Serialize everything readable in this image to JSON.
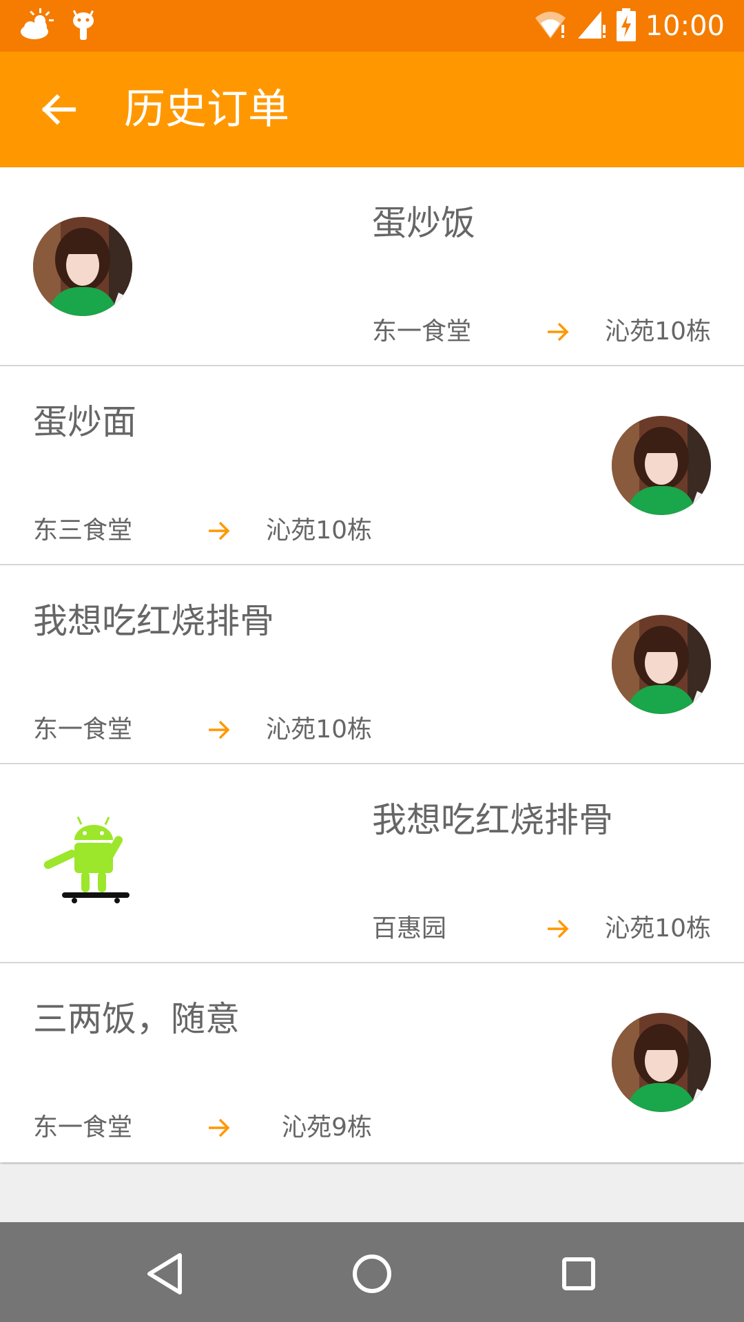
{
  "status_bar": {
    "time": "10:00",
    "icons": [
      "weather-icon",
      "android-debug-icon",
      "wifi-icon",
      "signal-icon",
      "battery-charging-icon"
    ]
  },
  "app_bar": {
    "title": "历史订单",
    "back_icon": "arrow-left-icon"
  },
  "colors": {
    "status_bar": "#f57c00",
    "app_bar": "#ff9800",
    "arrow_accent": "#ff9800",
    "text_gray": "#666666",
    "nav_bar": "#757575"
  },
  "orders": [
    {
      "title": "蛋炒饭",
      "from": "东一食堂",
      "to": "沁苑10栋",
      "avatar": "girl-avatar",
      "layout": "avatar-left"
    },
    {
      "title": "蛋炒面",
      "from": "东三食堂",
      "to": "沁苑10栋",
      "avatar": "girl-avatar",
      "layout": "avatar-right"
    },
    {
      "title": "我想吃红烧排骨",
      "from": "东一食堂",
      "to": "沁苑10栋",
      "avatar": "girl-avatar",
      "layout": "avatar-right"
    },
    {
      "title": "我想吃红烧排骨",
      "from": "百惠园",
      "to": "沁苑10栋",
      "avatar": "android-skateboard-avatar",
      "layout": "avatar-left"
    },
    {
      "title": "三两饭，随意",
      "from": "东一食堂",
      "to": "沁苑9栋",
      "avatar": "girl-avatar",
      "layout": "avatar-right"
    }
  ],
  "nav_bar": {
    "buttons": [
      "back-triangle-icon",
      "home-circle-icon",
      "recents-square-icon"
    ]
  }
}
